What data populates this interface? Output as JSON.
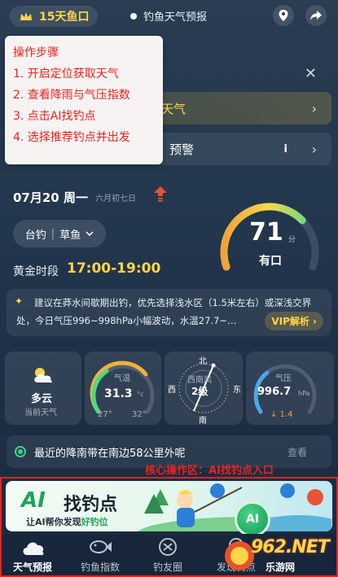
{
  "top_bar": {
    "days_label": "15天鱼口",
    "forecast_label": "钓鱼天气预报",
    "icons": [
      "location-icon",
      "share-icon"
    ]
  },
  "banners": {
    "weather_text": "天气",
    "alert_text": "预警"
  },
  "popup": {
    "title": "操作步骤",
    "steps": [
      "1. 开启定位获取天气",
      "2. 查看降雨与气压指数",
      "3. 点击AI找钓点",
      "4. 选择推荐钓点并出发"
    ]
  },
  "date": {
    "main": "07月20 周一",
    "lunar": "六月初七日"
  },
  "fishing": {
    "method": "台钓",
    "fish": "草鱼",
    "golden_label": "黄金时段",
    "golden_time": "17:00-19:00"
  },
  "score": {
    "value": "71",
    "unit": "分",
    "label": "有口",
    "level": 0.71
  },
  "advice": {
    "line1": "建议在莽水间歇期出钓，优先选择浅水区（1.5米左右）或深浅交界",
    "line2": "处，今日气压996~998hPa小幅波动，水温27.7~…",
    "vip": "VIP解析 ›"
  },
  "cards": {
    "weather": {
      "value": "多云",
      "label": "当前天气"
    },
    "temperature": {
      "label": "气温",
      "value": "31.3",
      "unit": "°c",
      "min": "27°",
      "max": "32°"
    },
    "wind": {
      "north": "北",
      "south": "南",
      "east": "东",
      "west": "西",
      "direction": "西南风",
      "level": "2级"
    },
    "pressure": {
      "label": "气压",
      "value": "996.7",
      "unit": "hPa",
      "change": "↓ 1.4"
    }
  },
  "rain_notice": {
    "text": "最近的降南带在南边58公里外呢",
    "more": "查看"
  },
  "core": {
    "label": "核心操作区：AI找钓点入口"
  },
  "ai_banner": {
    "ai": "AI",
    "title": "找钓点",
    "sub_prefix": "让AI帮你发现",
    "sub_highlight": "好钓位",
    "button": "AI"
  },
  "nav": {
    "items": [
      "天气预报",
      "钓鱼指数",
      "钓友圈",
      "发现钓点"
    ]
  },
  "watermark": {
    "big": "962.NET",
    "small": "乐游网"
  },
  "colors": {
    "accent_gold": "#ffd54a",
    "accent_red": "#e8231f",
    "accent_green": "#1fa35b"
  }
}
